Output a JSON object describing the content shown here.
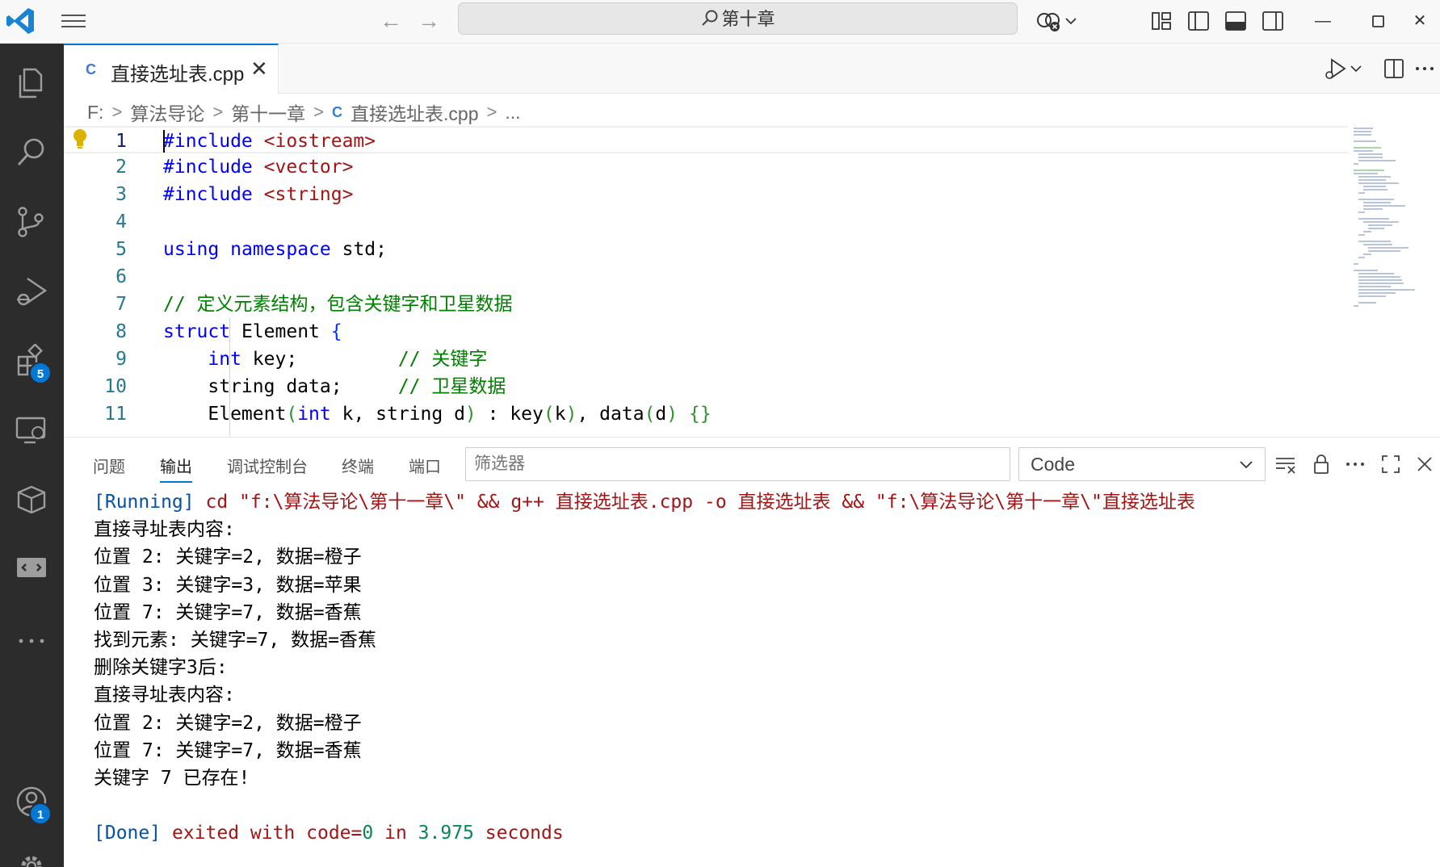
{
  "titlebar": {
    "search_text": "第十章",
    "accent": "#0078d4"
  },
  "activity": {
    "items": [
      "explorer-icon",
      "search-icon",
      "source-control-icon",
      "run-debug-icon",
      "extensions-icon",
      "remote-explorer-icon",
      "packages-icon",
      "remote-icon",
      "more-icon",
      "account-icon",
      "settings-icon"
    ],
    "extensions_badge": "5",
    "account_badge": "1"
  },
  "tab": {
    "icon": "C",
    "label": "直接选址表.cpp",
    "close": "✕"
  },
  "breadcrumb": {
    "drive": "F:",
    "folder1": "算法导论",
    "folder2": "第十一章",
    "file": "直接选址表.cpp",
    "more": "..."
  },
  "editor": {
    "line_numbers": [
      "1",
      "2",
      "3",
      "4",
      "5",
      "6",
      "7",
      "8",
      "9",
      "10",
      "11"
    ],
    "lines": {
      "l1_kw": "#include",
      "l1_str": "<iostream>",
      "l2_kw": "#include",
      "l2_str": "<vector>",
      "l3_kw": "#include",
      "l3_str": "<string>",
      "l5_kw1": "using",
      "l5_kw2": "namespace",
      "l5_rest": "std;",
      "l7_cm": "// 定义元素结构，包含关键字和卫星数据",
      "l8_kw": "struct",
      "l8_name": "Element",
      "l8_brace": "{",
      "l9_type": "int",
      "l9_rest": "key;",
      "l9_cm": "// 关键字",
      "l10_rest": "string data;",
      "l10_cm": "// 卫星数据",
      "l11_a": "Element",
      "l11_p1": "(",
      "l11_int": "int",
      "l11_b": "k, string d",
      "l11_p2": ")",
      "l11_c": ": key",
      "l11_p3": "(",
      "l11_k": "k",
      "l11_p4": ")",
      "l11_d": ", data",
      "l11_p5": "(",
      "l11_dd": "d",
      "l11_p6": ")",
      "l11_braces": "{}"
    }
  },
  "panel": {
    "tabs": [
      "问题",
      "输出",
      "调试控制台",
      "终端",
      "端口"
    ],
    "active_tab": "输出",
    "filter_placeholder": "筛选器",
    "channel": "Code",
    "output": {
      "running_tag": "[Running]",
      "running_cmd": "cd \"f:\\算法导论\\第十一章\\\" && g++ 直接选址表.cpp -o 直接选址表 && \"f:\\算法导论\\第十一章\\\"直接选址表",
      "lines": [
        "直接寻址表内容:",
        "位置 2: 关键字=2, 数据=橙子",
        "位置 3: 关键字=3, 数据=苹果",
        "位置 7: 关键字=7, 数据=香蕉",
        "找到元素: 关键字=7, 数据=香蕉",
        "删除关键字3后:",
        "直接寻址表内容:",
        "位置 2: 关键字=2, 数据=橙子",
        "位置 7: 关键字=7, 数据=香蕉",
        "关键字 7 已存在!"
      ],
      "done_tag": "[Done]",
      "done_text1": "exited with",
      "done_code_label": "code=",
      "done_code": "0",
      "done_in": "in",
      "done_secs": "3.975",
      "done_unit": "seconds"
    }
  }
}
